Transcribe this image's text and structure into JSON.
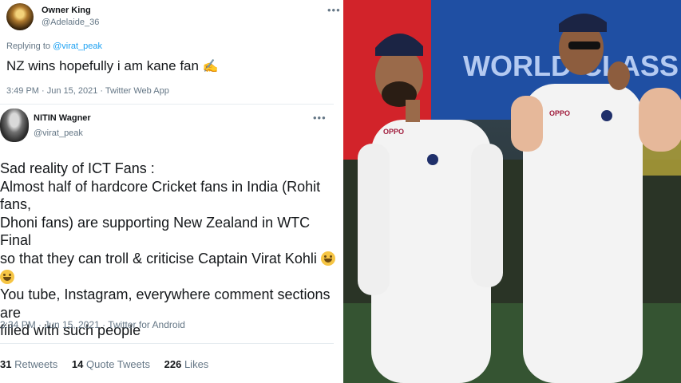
{
  "tweet_reply": {
    "name": "Owner King",
    "handle": "@Adelaide_36",
    "replying_prefix": "Replying to",
    "replying_handle": "@virat_peak",
    "text": "NZ wins hopefully i am kane fan",
    "emoji": "✍",
    "timestamp": "3:49 PM · Jun 15, 2021 · Twitter Web App",
    "more": "•••"
  },
  "tweet_main": {
    "name": "NITIN Wagner",
    "handle": "@virat_peak",
    "more": "•••",
    "lines": [
      "Sad reality of ICT Fans :",
      "Almost half of hardcore Cricket fans in India (Rohit fans,",
      "Dhoni fans) are supporting New Zealand in WTC Final",
      "so that they can troll & criticise Captain Virat Kohli"
    ],
    "lines_after": [
      "You tube, Instagram, everywhere comment sections are",
      "filled with such people"
    ],
    "timestamp": "3:34 PM · Jun 15, 2021 · Twitter for Android",
    "retweets_count": "31",
    "retweets_label": "Retweets",
    "quotes_count": "14",
    "quotes_label": "Quote Tweets",
    "likes_count": "226",
    "likes_label": "Likes"
  },
  "photo": {
    "banner_text": "WORLD-CLASS LUBR",
    "jersey_text_left": "OPPO",
    "jersey_text_right": "OPPO",
    "colors": {
      "banner": "#1f4fa3",
      "red": "#d2232a",
      "jersey": "#f3f3f3"
    }
  }
}
